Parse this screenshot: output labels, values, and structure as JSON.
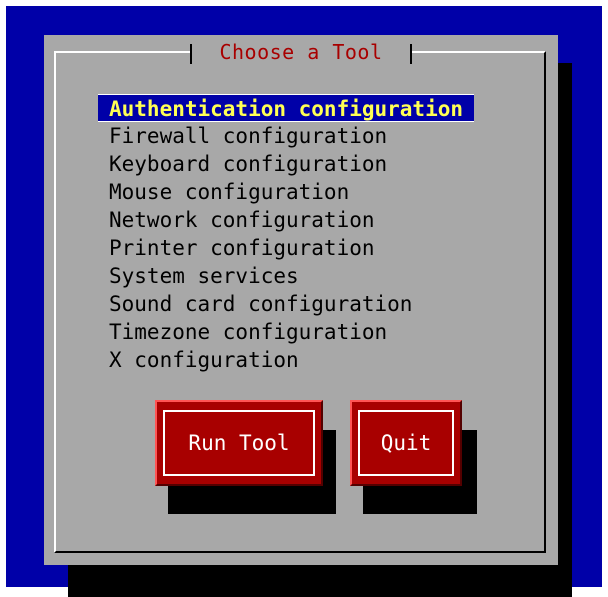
{
  "dialog": {
    "title": "Choose a Tool",
    "tools": [
      {
        "label": "Authentication configuration",
        "selected": true
      },
      {
        "label": "Firewall configuration",
        "selected": false
      },
      {
        "label": "Keyboard configuration",
        "selected": false
      },
      {
        "label": "Mouse configuration",
        "selected": false
      },
      {
        "label": "Network configuration",
        "selected": false
      },
      {
        "label": "Printer configuration",
        "selected": false
      },
      {
        "label": "System services",
        "selected": false
      },
      {
        "label": "Sound card configuration",
        "selected": false
      },
      {
        "label": "Timezone configuration",
        "selected": false
      },
      {
        "label": "X configuration",
        "selected": false
      }
    ],
    "buttons": {
      "run_label": "Run Tool",
      "quit_label": "Quit"
    }
  },
  "colors": {
    "screen_background": "#0000a8",
    "dialog_background": "#a8a8a8",
    "title_text": "#a80000",
    "selection_background": "#0000a8",
    "selection_text": "#ffff54",
    "button_background": "#a80000",
    "button_text": "#ffffff"
  }
}
